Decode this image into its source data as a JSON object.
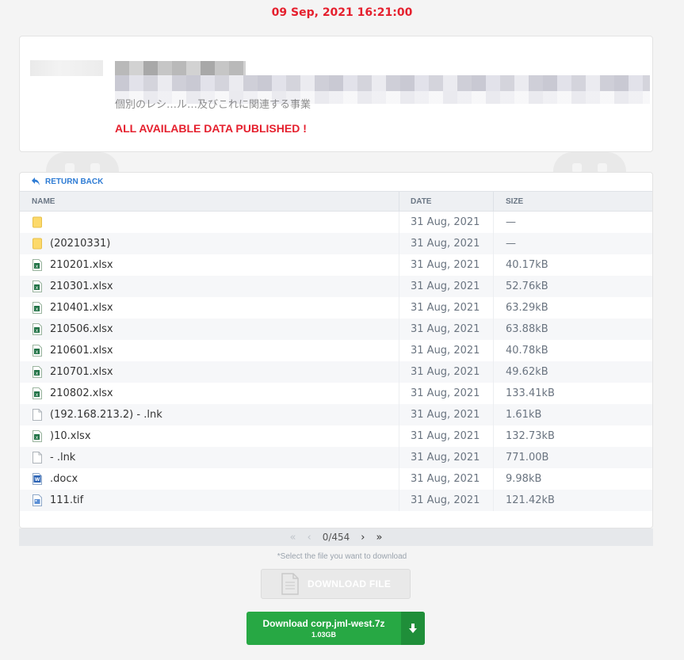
{
  "timestamp": "09 Sep, 2021 16:21:00",
  "info": {
    "subtitle": "個別のレシ…ル…及びこれに関連する事業",
    "status": "ALL AVAILABLE DATA PUBLISHED !"
  },
  "files": {
    "return_label": "RETURN BACK",
    "columns": {
      "name": "NAME",
      "date": "DATE",
      "size": "SIZE"
    },
    "rows": [
      {
        "type": "folder",
        "name": "",
        "date": "31 Aug, 2021",
        "size": "—"
      },
      {
        "type": "folder",
        "name": "(20210331)",
        "date": "31 Aug, 2021",
        "size": "—"
      },
      {
        "type": "xlsx",
        "name": "210201.xlsx",
        "date": "31 Aug, 2021",
        "size": "40.17kB"
      },
      {
        "type": "xlsx",
        "name": "210301.xlsx",
        "date": "31 Aug, 2021",
        "size": "52.76kB"
      },
      {
        "type": "xlsx",
        "name": "210401.xlsx",
        "date": "31 Aug, 2021",
        "size": "63.29kB"
      },
      {
        "type": "xlsx",
        "name": "210506.xlsx",
        "date": "31 Aug, 2021",
        "size": "63.88kB"
      },
      {
        "type": "xlsx",
        "name": "210601.xlsx",
        "date": "31 Aug, 2021",
        "size": "40.78kB"
      },
      {
        "type": "xlsx",
        "name": "210701.xlsx",
        "date": "31 Aug, 2021",
        "size": "49.62kB"
      },
      {
        "type": "xlsx",
        "name": "210802.xlsx",
        "date": "31 Aug, 2021",
        "size": "133.41kB"
      },
      {
        "type": "file",
        "name": "(192.168.213.2) - .lnk",
        "date": "31 Aug, 2021",
        "size": "1.61kB"
      },
      {
        "type": "xlsx",
        "name": ")10.xlsx",
        "date": "31 Aug, 2021",
        "size": "132.73kB"
      },
      {
        "type": "file",
        "name": "- .lnk",
        "date": "31 Aug, 2021",
        "size": "771.00B"
      },
      {
        "type": "docx",
        "name": ".docx",
        "date": "31 Aug, 2021",
        "size": "9.98kB"
      },
      {
        "type": "tif",
        "name": "111.tif",
        "date": "31 Aug, 2021",
        "size": "121.42kB"
      }
    ]
  },
  "pager": {
    "first": "«",
    "prev": "‹",
    "label": "0/454",
    "next": "›",
    "last": "»"
  },
  "hint": "*Select the file you want to download",
  "download_file_label": "DOWNLOAD FILE",
  "archive": {
    "label": "Download corp.jml-west.7z",
    "size": "1.03GB"
  },
  "colors": {
    "accent_red": "#e5202e",
    "link_blue": "#2d7bd4",
    "green": "#27a844"
  }
}
